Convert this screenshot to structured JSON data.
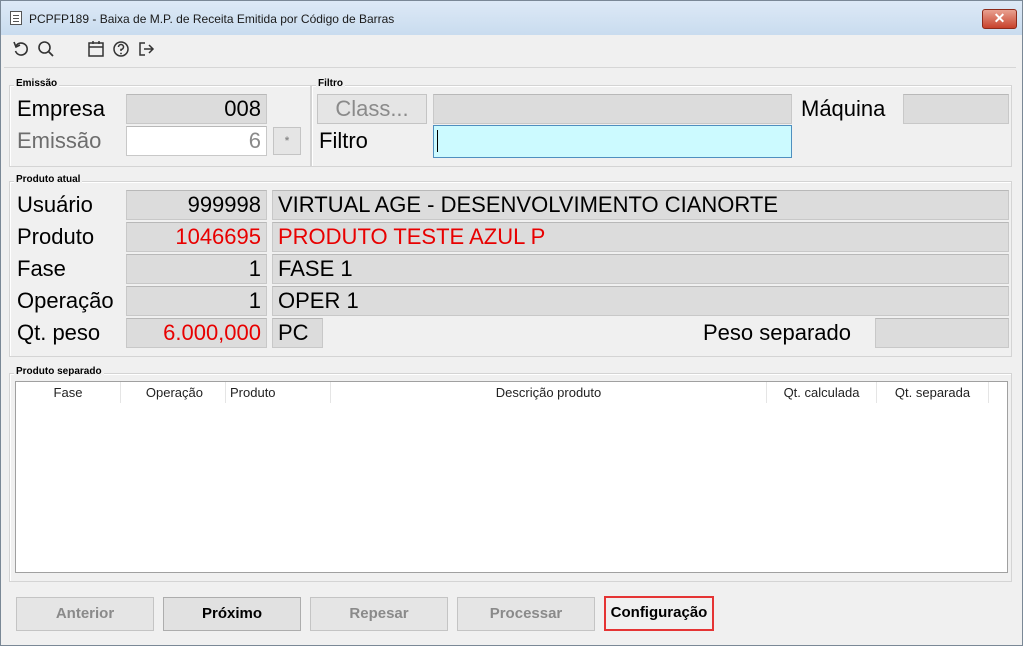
{
  "window": {
    "title": "PCPFP189 - Baixa de M.P. de Receita Emitida por Código de Barras",
    "close_label": "✕"
  },
  "toolbar": {
    "icons": [
      "refresh-icon",
      "search-icon",
      "calendar-icon",
      "help-icon",
      "exit-icon"
    ]
  },
  "emissao": {
    "legend": "Emissão",
    "empresa_label": "Empresa",
    "empresa_value": "008",
    "emissao_label": "Emissão",
    "emissao_value": "6",
    "spin_label": "*"
  },
  "filtro": {
    "legend": "Filtro",
    "class_button": "Class...",
    "class_value": "",
    "maquina_label": "Máquina",
    "maquina_value": "",
    "filtro_label": "Filtro",
    "filtro_value": ""
  },
  "produto_atual": {
    "legend": "Produto atual",
    "usuario_label": "Usuário",
    "usuario_code": "999998",
    "usuario_name": "VIRTUAL AGE - DESENVOLVIMENTO CIANORTE",
    "produto_label": "Produto",
    "produto_code": "1046695",
    "produto_name": "PRODUTO TESTE AZUL P",
    "fase_label": "Fase",
    "fase_code": "1",
    "fase_name": "FASE 1",
    "operacao_label": "Operação",
    "operacao_code": "1",
    "operacao_name": "OPER 1",
    "qtpeso_label": "Qt. peso",
    "qtpeso_value": "6.000,000",
    "unit": "PC",
    "peso_separado_label": "Peso separado",
    "peso_separado_value": ""
  },
  "produto_separado": {
    "legend": "Produto separado",
    "columns": [
      "Fase",
      "Operação",
      "Produto",
      "Descrição produto",
      "Qt. calculada",
      "Qt. separada"
    ],
    "rows": []
  },
  "buttons": {
    "anterior": "Anterior",
    "proximo": "Próximo",
    "repesar": "Repesar",
    "processar": "Processar",
    "configuracao": "Configuração"
  },
  "colors": {
    "highlight_red": "#e80000",
    "filter_field": "#ccfaff",
    "focus_border": "#e53434"
  }
}
